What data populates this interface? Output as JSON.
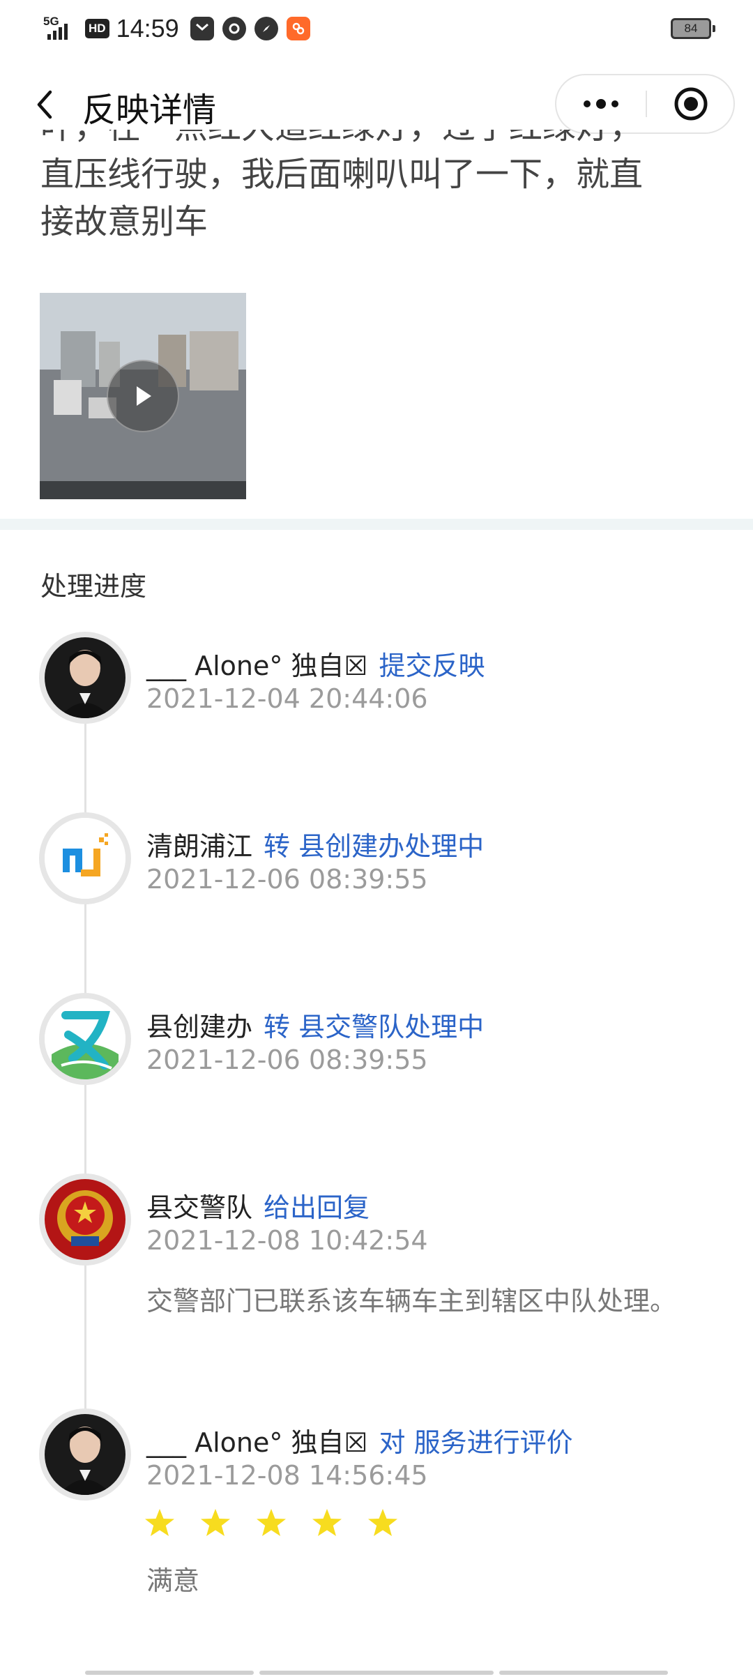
{
  "status_bar": {
    "network": "5G",
    "hd": "HD",
    "time": "14:59",
    "battery": "84"
  },
  "nav": {
    "title": "反映详情"
  },
  "report": {
    "description_partial_line": "叶，在一点红大道红绿灯，过了红绿灯，",
    "description_line_2": "直压线行驶，我后面喇叭叫了一下，就直",
    "description_line_3": "接故意别车"
  },
  "progress": {
    "title": "处理进度",
    "entries": [
      {
        "name": "___ Alone°  独自☒",
        "action": "提交反映",
        "time": "2021-12-04 20:44:06"
      },
      {
        "name": "清朗浦江",
        "action": "转 县创建办处理中",
        "time": "2021-12-06 08:39:55"
      },
      {
        "name": "县创建办",
        "action": "转 县交警队处理中",
        "time": "2021-12-06 08:39:55"
      },
      {
        "name": "县交警队",
        "action": "给出回复",
        "time": "2021-12-08 10:42:54",
        "reply": "交警部门已联系该车辆车主到辖区中队处理。"
      },
      {
        "name": "___ Alone°  独自☒",
        "action": "对 服务进行评价",
        "time": "2021-12-08 14:56:45",
        "rating": 5,
        "rating_max": 5,
        "rating_label": "满意"
      }
    ]
  },
  "colors": {
    "accent_blue": "#2b64c8",
    "star_yellow": "#f7dc1f",
    "secondary_text": "#9b9b9b",
    "separator": "#eff5f6"
  }
}
